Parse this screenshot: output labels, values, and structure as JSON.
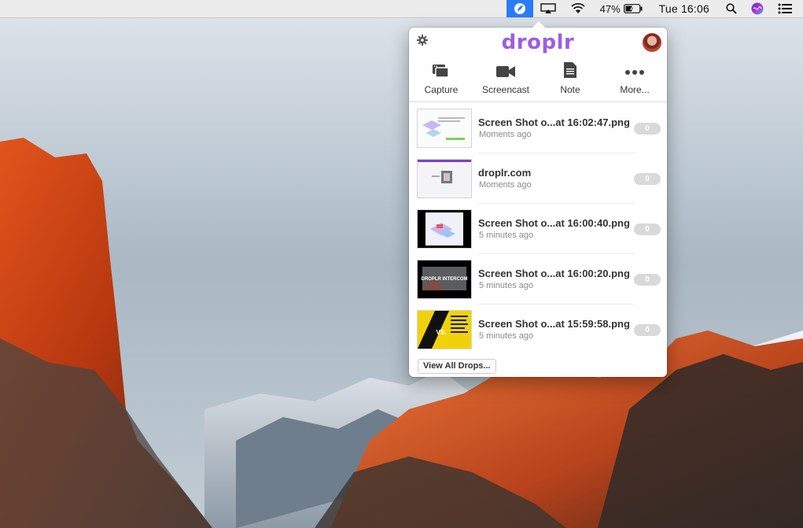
{
  "menubar": {
    "icons": [
      "droplr-icon",
      "airplay-icon",
      "wifi-icon",
      "battery-icon",
      "search-icon",
      "siri-icon",
      "notification-list-icon"
    ],
    "battery": "47%",
    "clock": "Tue 16:06"
  },
  "droplr": {
    "logo": "droplr",
    "toolbar": [
      {
        "label": "Capture",
        "icon": "capture-icon"
      },
      {
        "label": "Screencast",
        "icon": "video-camera-icon"
      },
      {
        "label": "Note",
        "icon": "note-icon"
      },
      {
        "label": "More...",
        "icon": "more-icon"
      }
    ],
    "drops": [
      {
        "title": "Screen Shot o...at 16:02:47.png",
        "time": "Moments ago",
        "count": "0"
      },
      {
        "title": "droplr.com",
        "time": "Moments ago",
        "count": "0"
      },
      {
        "title": "Screen Shot o...at 16:00:40.png",
        "time": "5 minutes ago",
        "count": "0"
      },
      {
        "title": "Screen Shot o...at 16:00:20.png",
        "time": "5 minutes ago",
        "count": "0"
      },
      {
        "title": "Screen Shot o...at 15:59:58.png",
        "time": "5 minutes ago",
        "count": "0"
      }
    ],
    "view_all": "View All Drops...",
    "thumb_text": {
      "intercom": "DROPLR INTERCOM",
      "vs": "VS."
    }
  },
  "colors": {
    "accent": "#2a7cf6",
    "brand": "#9b5de5"
  }
}
